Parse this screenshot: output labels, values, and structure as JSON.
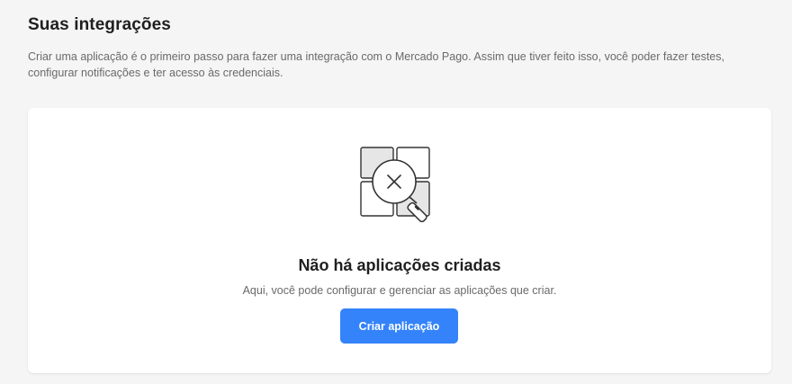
{
  "header": {
    "title": "Suas integrações",
    "description": "Criar uma aplicação é o primeiro passo para fazer uma integração com o Mercado Pago. Assim que tiver feito isso, você poder fazer testes, configurar notificações e ter acesso às credenciais."
  },
  "empty_state": {
    "icon": "search-not-found-grid-icon",
    "title": "Não há aplicações criadas",
    "subtitle": "Aqui, você pode configurar e gerenciar as aplicações que criar.",
    "button_label": "Criar aplicação"
  },
  "colors": {
    "accent": "#3483fa",
    "background": "#f5f5f5",
    "card": "#ffffff"
  }
}
